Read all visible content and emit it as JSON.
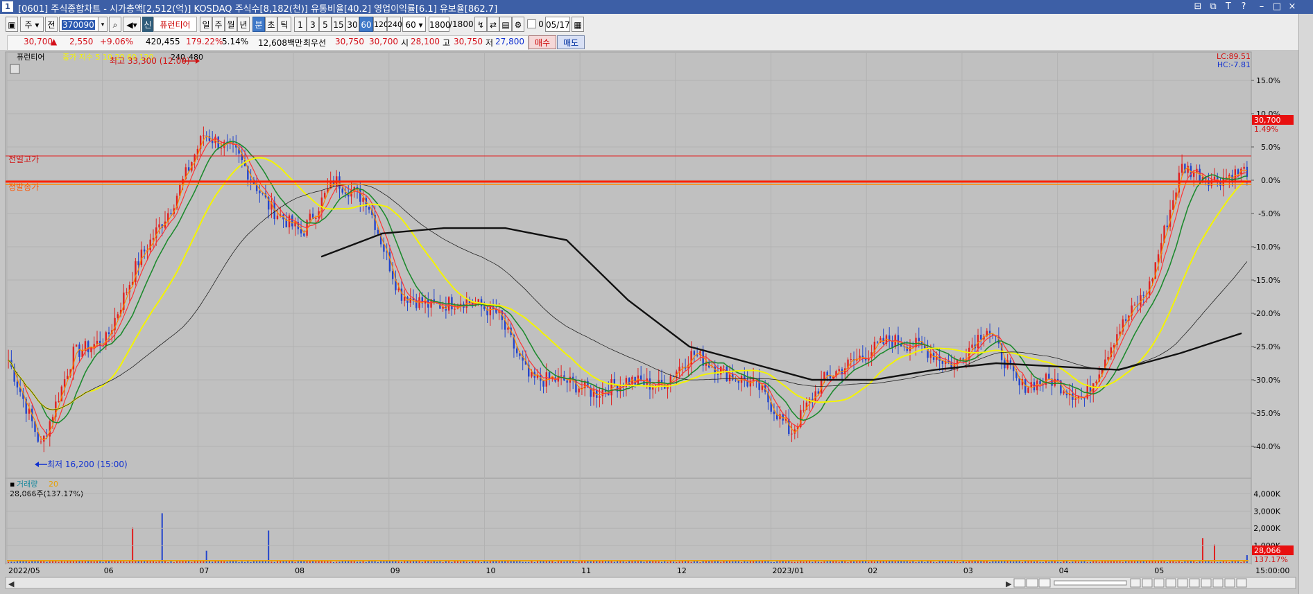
{
  "window": {
    "icon": "1",
    "title": "[0601] 주식종합차트 - 시가총액[2,512(억)] KOSDAQ 주식수[8,182(천)] 유통비율[40.2] 영업이익률[6.1] 유보율[862.7]",
    "controls": [
      "⊟",
      "⧉",
      "T",
      "?",
      "–",
      "□",
      "×"
    ]
  },
  "toolbar": {
    "market": "주",
    "prefix": "전",
    "code": "370090",
    "badge": "신",
    "name": "퓨런티어",
    "periods": [
      "일",
      "주",
      "월",
      "년",
      "분",
      "초",
      "틱"
    ],
    "active_period": "분",
    "minutes": [
      "1",
      "3",
      "5",
      "15",
      "30",
      "60",
      "120",
      "240"
    ],
    "active_minute": "60",
    "interval_value": "60",
    "count": "1800",
    "count_total": "/1800",
    "checkbox_value": "0",
    "date": "05/17"
  },
  "info": {
    "price": "30,700",
    "price_arrow": "▲",
    "change": "2,550",
    "change_pct": "+9.06%",
    "volume": "420,455",
    "volume_ratio": "179.22%",
    "turnover": "5.14%",
    "amount": "12,608백만",
    "best_label": "최우선",
    "ask": "30,750",
    "bid": "30,700",
    "open_label": "시",
    "open": "28,100",
    "high_label": "고",
    "high": "30,750",
    "low_label": "저",
    "low": "27,800",
    "buy_button": "매수",
    "sell_button": "매도"
  },
  "chart": {
    "name_label": "퓨런티어",
    "ma_label": "종가 지수 5 10 20 60 120",
    "ma_extra": [
      "240",
      "480"
    ],
    "lc_label": "LC:89.51",
    "hc_label": "HC:-7.81",
    "high_annotation": "최고 33,300 (12:00)",
    "low_annotation": "최저 16,200 (15:00)",
    "prev_high_label": "전일고가",
    "base_price_label": "정발송가",
    "current_price_tag": "30,700",
    "current_pct_tag": "1.49%",
    "volume_label": "거래량",
    "volume_ma": "20",
    "volume_value": "28,066주(137.17%)",
    "volume_tag": "28,066",
    "volume_pct_tag": "137.17%",
    "time_label": "15:00:00",
    "colors": {
      "background": "#c0c0c0",
      "up": "#e02020",
      "down": "#2244cc",
      "ma5": "#ff8800",
      "ma10": "#ff3333",
      "ma20": "#1d8a2e",
      "ma60": "#f4f400",
      "ma120": "#111111",
      "ref_line": "#ff2200",
      "volume_bar": "#e8a000"
    }
  },
  "chart_data": {
    "type": "candlestick",
    "title": "퓨런티어",
    "xlabel": "",
    "ylabel": "",
    "x_ticks": [
      "2022/05",
      "06",
      "07",
      "08",
      "09",
      "10",
      "11",
      "12",
      "2023/01",
      "02",
      "03",
      "04",
      "05"
    ],
    "y_ticks": [
      "15.0%",
      "10.0%",
      "5.0%",
      "0.0%",
      "-5.0%",
      "-10.0%",
      "-15.0%",
      "-20.0%",
      "-25.0%",
      "-30.0%",
      "-35.0%",
      "-40.0%"
    ],
    "ylim": [
      -42,
      18
    ],
    "approx_close_pct_path": [
      {
        "x": "2022/05",
        "y": -27
      },
      {
        "x": "2022/05b",
        "y": -40
      },
      {
        "x": "2022/05c",
        "y": -26
      },
      {
        "x": "06",
        "y": -24
      },
      {
        "x": "06b",
        "y": -12
      },
      {
        "x": "06c",
        "y": -4
      },
      {
        "x": "07",
        "y": 7
      },
      {
        "x": "07b",
        "y": 4
      },
      {
        "x": "07c",
        "y": -4
      },
      {
        "x": "08",
        "y": -8
      },
      {
        "x": "08b",
        "y": 0
      },
      {
        "x": "08c",
        "y": -3
      },
      {
        "x": "09",
        "y": -17
      },
      {
        "x": "09b",
        "y": -19
      },
      {
        "x": "09c",
        "y": -18
      },
      {
        "x": "10",
        "y": -20
      },
      {
        "x": "10b",
        "y": -30
      },
      {
        "x": "10c",
        "y": -30
      },
      {
        "x": "11",
        "y": -32
      },
      {
        "x": "11b",
        "y": -30
      },
      {
        "x": "11c",
        "y": -31
      },
      {
        "x": "12",
        "y": -26
      },
      {
        "x": "12b",
        "y": -29
      },
      {
        "x": "12c",
        "y": -31
      },
      {
        "x": "2023/01",
        "y": -38
      },
      {
        "x": "2023/01b",
        "y": -30
      },
      {
        "x": "2023/01c",
        "y": -27
      },
      {
        "x": "02",
        "y": -24
      },
      {
        "x": "02b",
        "y": -25
      },
      {
        "x": "02c",
        "y": -28
      },
      {
        "x": "03",
        "y": -22
      },
      {
        "x": "03b",
        "y": -31
      },
      {
        "x": "03c",
        "y": -30
      },
      {
        "x": "04",
        "y": -33
      },
      {
        "x": "04b",
        "y": -23
      },
      {
        "x": "04c",
        "y": -16
      },
      {
        "x": "05",
        "y": 2
      },
      {
        "x": "05b",
        "y": 0
      },
      {
        "x": "05c",
        "y": 1.5
      }
    ],
    "ma120_pct_path": [
      {
        "x": "2022/08",
        "y": -11.5
      },
      {
        "x": "08c",
        "y": -8
      },
      {
        "x": "09",
        "y": -7.2
      },
      {
        "x": "09c",
        "y": -7.2
      },
      {
        "x": "10",
        "y": -9
      },
      {
        "x": "11",
        "y": -18
      },
      {
        "x": "12",
        "y": -25
      },
      {
        "x": "12c",
        "y": -27.5
      },
      {
        "x": "2023/01",
        "y": -30
      },
      {
        "x": "02",
        "y": -30
      },
      {
        "x": "03",
        "y": -28.5
      },
      {
        "x": "03c",
        "y": -27.5
      },
      {
        "x": "04",
        "y": -28
      },
      {
        "x": "04c",
        "y": -28.5
      },
      {
        "x": "05",
        "y": -26
      },
      {
        "x": "05c",
        "y": -23
      }
    ],
    "volume_y_ticks": [
      "4,000K",
      "3,000K",
      "2,000K",
      "1,000K"
    ],
    "volume_ylim": [
      0,
      4500
    ]
  }
}
